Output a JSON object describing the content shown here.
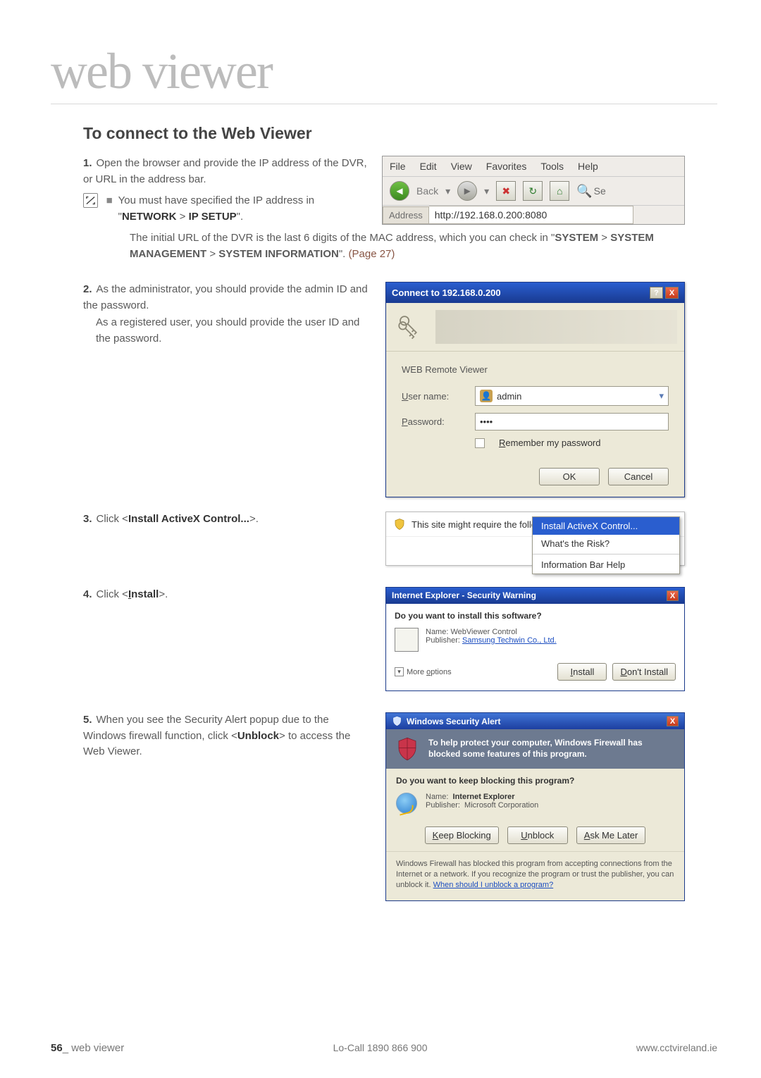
{
  "title": "web viewer",
  "section": "To connect to the Web Viewer",
  "steps": {
    "s1": {
      "n": "1.",
      "text_a": "Open the browser and provide the IP address of the DVR, or URL in the address bar."
    },
    "note": {
      "bullet": "■",
      "lead": "You must have specified the IP address in \"",
      "b1": "NETWORK",
      "gt": " > ",
      "b2": "IP SETUP",
      "tail": "\"."
    },
    "note2": {
      "a": "The initial URL of the DVR is the last 6 digits of the MAC address, which you can check in \"",
      "b1": "SYSTEM",
      "gt1": " > ",
      "b2": "SYSTEM MANAGEMENT",
      "gt2": " > ",
      "b3": "SYSTEM INFORMATION",
      "tail": "\". ",
      "page": "(Page 27)"
    },
    "s2": {
      "n": "2.",
      "a": "As the administrator, you should provide the admin ID and the password.",
      "b": "As a registered user, you should provide the user ID and the password."
    },
    "s3": {
      "n": "3.",
      "a": "Click <",
      "b": "Install ActiveX Control...",
      "c": ">."
    },
    "s4": {
      "n": "4.",
      "a": "Click <",
      "b": "Install",
      "c": ">."
    },
    "s5": {
      "n": "5.",
      "a": "When you see the Security Alert popup due to the Windows firewall function, click <",
      "b": "Unblock",
      "c": "> to access the Web Viewer."
    }
  },
  "ie": {
    "menu": [
      "File",
      "Edit",
      "View",
      "Favorites",
      "Tools",
      "Help"
    ],
    "back": "Back",
    "se": "Se",
    "addr_label": "Address",
    "addr_value": "http://192.168.0.200:8080"
  },
  "login": {
    "title": "Connect to 192.168.0.200",
    "app": "WEB Remote Viewer",
    "user_lbl": "User name:",
    "user_u": "U",
    "user_val": "admin",
    "pass_lbl": "Password:",
    "pass_u": "P",
    "pass_val": "••••",
    "remember": "Remember my password",
    "rem_u": "R",
    "ok": "OK",
    "cancel": "Cancel",
    "help": "?",
    "close": "X"
  },
  "infobar": {
    "msg": "This site might require the following ActiveX control:",
    "menu1": "Install ActiveX Control...",
    "menu2": "What's the Risk?",
    "menu3": "Information Bar Help"
  },
  "secwarn": {
    "title": "Internet Explorer - Security Warning",
    "q": "Do you want to install this software?",
    "name_l": "Name:",
    "name_v": "WebViewer Control",
    "pub_l": "Publisher:",
    "pub_v": "Samsung Techwin Co., Ltd.",
    "more": "More options",
    "more_u": "o",
    "install": "Install",
    "install_u": "I",
    "dont": "Don't Install",
    "dont_u": "D",
    "close": "X"
  },
  "fw": {
    "title": "Windows Security Alert",
    "close": "X",
    "banner": "To help protect your computer, Windows Firewall has blocked some features of this program.",
    "q": "Do you want to keep blocking this program?",
    "name_l": "Name:",
    "name_v": "Internet Explorer",
    "pub_l": "Publisher:",
    "pub_v": "Microsoft Corporation",
    "keep": "Keep Blocking",
    "keep_u": "K",
    "unblock": "Unblock",
    "unblock_u": "U",
    "ask": "Ask Me Later",
    "ask_u": "A",
    "note_a": "Windows Firewall has blocked this program from accepting connections from the Internet or a network. If you recognize the program or trust the publisher, you can unblock it. ",
    "note_link": "When should I unblock a program?"
  },
  "footer": {
    "page_num": "56",
    "page_lbl": "_ web viewer",
    "center": "Lo-Call  1890 866 900",
    "right": "www.cctvireland.ie"
  }
}
